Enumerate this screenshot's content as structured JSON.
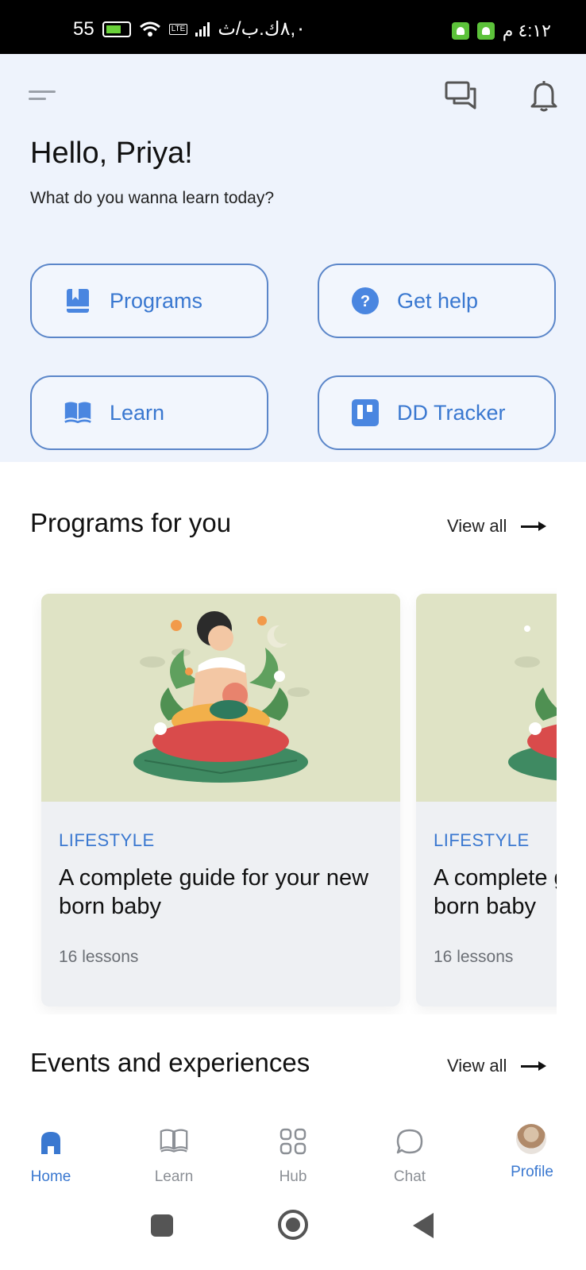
{
  "status_bar": {
    "network_speed": "55",
    "carrier_text": "٨,٠ك.ب/ث",
    "time": "٤:١٢ م",
    "lte_badge": "LTE"
  },
  "header": {
    "greeting": "Hello, Priya!",
    "subtitle": "What do you wanna learn today?"
  },
  "quick_actions": [
    {
      "label": "Programs",
      "icon": "bookmark-book-icon"
    },
    {
      "label": "Get help",
      "icon": "question-circle-icon"
    },
    {
      "label": "Learn",
      "icon": "open-book-icon"
    },
    {
      "label": "DD Tracker",
      "icon": "tracker-icon"
    }
  ],
  "programs_section": {
    "title": "Programs for you",
    "view_all": "View all"
  },
  "program_cards": [
    {
      "category": "LIFESTYLE",
      "title": "A complete guide for your new born baby",
      "lessons": "16 lessons"
    },
    {
      "category": "LIFESTYLE",
      "title": "A complete guide for your new born baby",
      "lessons": "16 lessons"
    }
  ],
  "events_section": {
    "title": "Events and experiences",
    "view_all": "View all"
  },
  "bottom_nav": [
    {
      "label": "Home",
      "icon": "home-icon",
      "active": true
    },
    {
      "label": "Learn",
      "icon": "book-icon",
      "active": false
    },
    {
      "label": "Hub",
      "icon": "grid-icon",
      "active": false
    },
    {
      "label": "Chat",
      "icon": "chat-bubble-icon",
      "active": false
    },
    {
      "label": "Profile",
      "icon": "avatar",
      "active": true
    }
  ],
  "colors": {
    "accent": "#3a78d0",
    "header_bg": "#eef3fc",
    "button_border": "#5b86c9"
  }
}
